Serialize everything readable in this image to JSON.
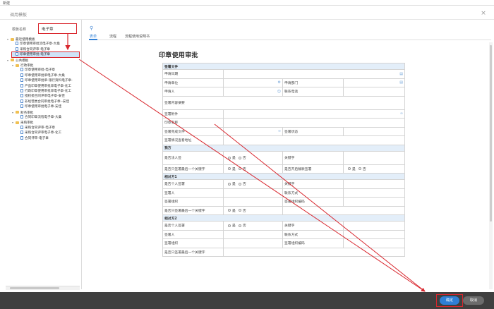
{
  "window": {
    "title": "新建"
  },
  "dialog": {
    "title": "调用模板",
    "close_symbol": "×"
  },
  "search": {
    "label": "模板名称",
    "value": "电子章"
  },
  "tree": [
    {
      "label": "最近使用模板",
      "level": 0,
      "type": "folder"
    },
    {
      "label": "印章使用审批流电子章-大桑",
      "level": 1,
      "type": "doc"
    },
    {
      "label": "采购合同评审-电子章",
      "level": 1,
      "type": "doc"
    },
    {
      "label": "印章使用审批-电子章",
      "level": 1,
      "type": "doc",
      "selected": true
    },
    {
      "label": "公共模板",
      "level": 0,
      "type": "folder"
    },
    {
      "label": "行政审批",
      "level": 1,
      "type": "folder"
    },
    {
      "label": "印章使用审批-电子章",
      "level": 2,
      "type": "doc"
    },
    {
      "label": "印章使用审批单电子章-大桑",
      "level": 2,
      "type": "doc"
    },
    {
      "label": "印章使用审批单-银行资料电子章-",
      "level": 2,
      "type": "doc"
    },
    {
      "label": "产品印章使用审批单电子章-化工",
      "level": 2,
      "type": "doc"
    },
    {
      "label": "行政印章使用审批单电子章-化工",
      "level": 2,
      "type": "doc"
    },
    {
      "label": "授权委合同评审电子章-安佳",
      "level": 2,
      "type": "doc"
    },
    {
      "label": "非经营类合同审批电子章--安佳",
      "level": 2,
      "type": "doc"
    },
    {
      "label": "印章使用审批电子章-安佳",
      "level": 2,
      "type": "doc"
    },
    {
      "label": "财务审批",
      "level": 1,
      "type": "folder"
    },
    {
      "label": "合同印章流程电子章-大桑",
      "level": 2,
      "type": "doc"
    },
    {
      "label": "采购审批",
      "level": 1,
      "type": "folder"
    },
    {
      "label": "采购合同评审-电子章",
      "level": 2,
      "type": "doc"
    },
    {
      "label": "采购合同评审电子章-化工",
      "level": 2,
      "type": "doc"
    },
    {
      "label": "合同评审-电子章",
      "level": 2,
      "type": "doc"
    }
  ],
  "tabs": [
    "表单",
    "流程",
    "流程使用说明书"
  ],
  "form": {
    "title": "印章使用审批",
    "sections": {
      "sign_doc": "签署文件",
      "party_a": "我方",
      "party_b1": "相对方1",
      "party_b2": "相对方2"
    },
    "fields": {
      "apply_date": "申请日期",
      "apply_unit": "申请单位",
      "apply_dept": "申请部门",
      "applicant": "申请人",
      "phone": "联系电话",
      "content_summary": "签署内容摘要",
      "sign_attachment": "签署附件",
      "seal_name": "印章名称",
      "completed_file": "签署完成文件",
      "sign_status": "签署状态",
      "view_address": "签署情况查看地址",
      "is_legal_sign": "是否法人签",
      "keyword": "关键字",
      "is_last_keyword": "是否只签署最后一个关键字",
      "auto_sign": "是否开启静默签署",
      "is_personal": "是否个人签署",
      "signer": "签署人",
      "contact": "联系方式",
      "sign_org": "签署组织",
      "org_code": "签署组织编码"
    },
    "yes": "是",
    "no": "否"
  },
  "footer": {
    "ok": "确定",
    "cancel": "取消"
  }
}
